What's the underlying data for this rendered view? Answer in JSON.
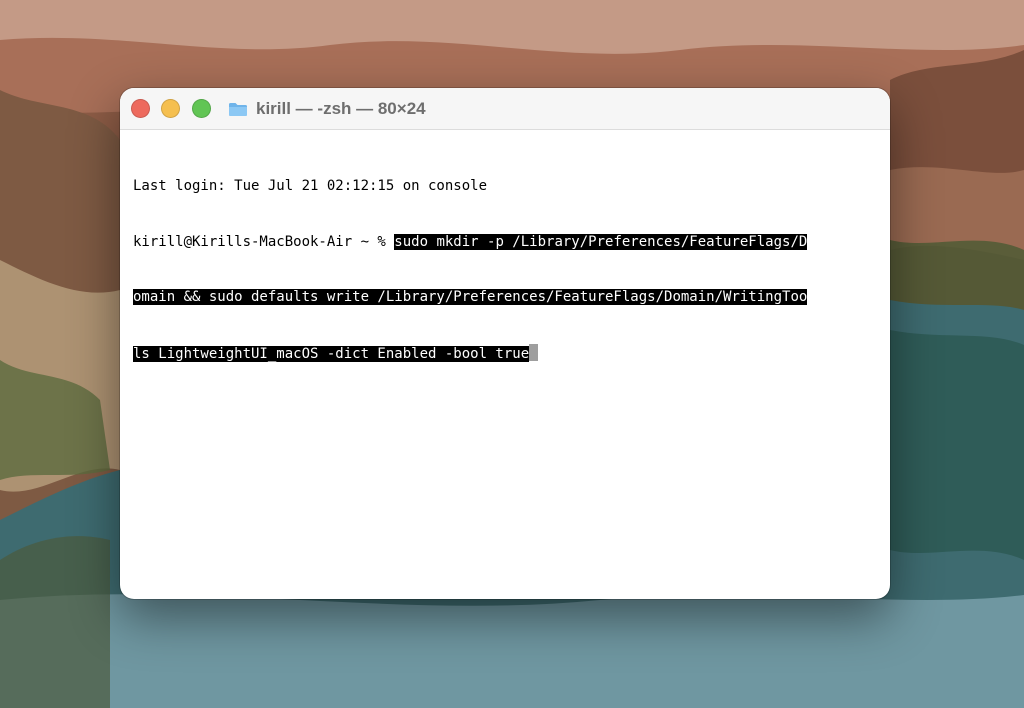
{
  "window": {
    "title": "kirill — -zsh — 80×24"
  },
  "terminal": {
    "last_login": "Last login: Tue Jul 21 02:12:15 on console",
    "prompt": "kirill@Kirills-MacBook-Air ~ % ",
    "command_lines": [
      "sudo mkdir -p /Library/Preferences/FeatureFlags/D",
      "omain && sudo defaults write /Library/Preferences/FeatureFlags/Domain/WritingToo",
      "ls LightweightUI_macOS -dict Enabled -bool true"
    ]
  },
  "colors": {
    "close": "#ed6a5e",
    "minimize": "#f5bf4f",
    "maximize": "#61c554",
    "selection": "#000000",
    "cursor": "#9e9e9e"
  },
  "icons": {
    "title_icon": "folder-icon"
  }
}
